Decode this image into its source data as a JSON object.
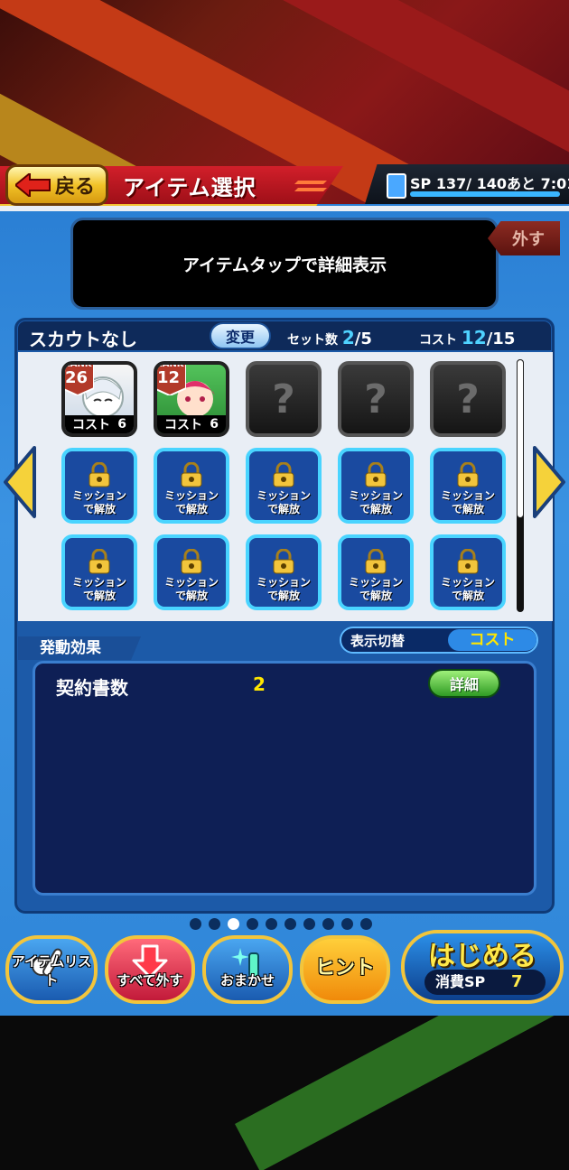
{
  "header": {
    "back_label": "戻る",
    "title": "アイテム選択",
    "sp_text": "SP 137/ 140あと  7:01"
  },
  "message": "アイテムタップで詳細表示",
  "remove_label": "外す",
  "scout": {
    "label": "スカウトなし",
    "change_label": "変更",
    "set_label": "セット数",
    "set_value": "2",
    "set_max": "5",
    "cost_label": "コスト",
    "cost_value": "12",
    "cost_max": "15"
  },
  "items": [
    {
      "rank_label": "RANK",
      "rank": "26",
      "cost_label": "コスト",
      "cost": "6",
      "color": "#f2f2f2"
    },
    {
      "rank_label": "RANK",
      "rank": "12",
      "cost_label": "コスト",
      "cost": "6",
      "color": "#3fb24a"
    }
  ],
  "empty_slot_mark": "?",
  "locked_label_1": "ミッション",
  "locked_label_2": "で解放",
  "effect": {
    "tab_label": "発動効果",
    "toggle_label": "表示切替",
    "toggle_value": "コスト",
    "rows": [
      {
        "name": "契約書数",
        "value": "2",
        "detail_label": "詳細"
      }
    ]
  },
  "page_dots": {
    "count": 10,
    "active": 2
  },
  "buttons": {
    "item_list": "アイテムリスト",
    "remove_all": "すべて外す",
    "auto": "おまかせ",
    "hint": "ヒント",
    "start": "はじめる",
    "consume_label": "消費SP",
    "consume_value": "7"
  },
  "colors": {
    "accent_red": "#d21f2a",
    "accent_gold": "#f2c53c",
    "panel_blue": "#1c5aa8",
    "lock_cyan": "#49d4ff"
  }
}
